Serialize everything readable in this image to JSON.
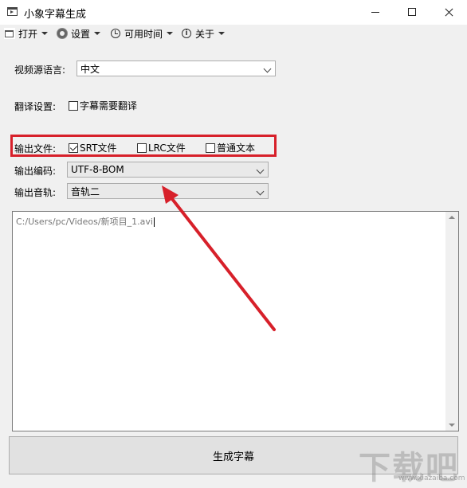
{
  "window": {
    "title": "小象字幕生成"
  },
  "menu": {
    "open": "打开",
    "settings": "设置",
    "available_time": "可用时间",
    "about": "关于"
  },
  "form": {
    "source_lang_label": "视频源语言:",
    "source_lang_value": "中文",
    "translate_label": "翻译设置:",
    "translate_checkbox": "字幕需要翻译",
    "translate_checked": false,
    "output_file_label": "输出文件:",
    "output_srt": "SRT文件",
    "output_srt_checked": true,
    "output_lrc": "LRC文件",
    "output_lrc_checked": false,
    "output_txt": "普通文本",
    "output_txt_checked": false,
    "encoding_label": "输出编码:",
    "encoding_value": "UTF-8-BOM",
    "track_label": "输出音轨:",
    "track_value": "音轨二"
  },
  "file_list": {
    "content": "C:/Users/pc/Videos/新项目_1.avi"
  },
  "generate_button": "生成字幕",
  "watermark": {
    "text": "下载吧",
    "url": "www.xiazaiba.com"
  },
  "colors": {
    "annotation": "#d7202a",
    "background": "#f0f0f0"
  }
}
